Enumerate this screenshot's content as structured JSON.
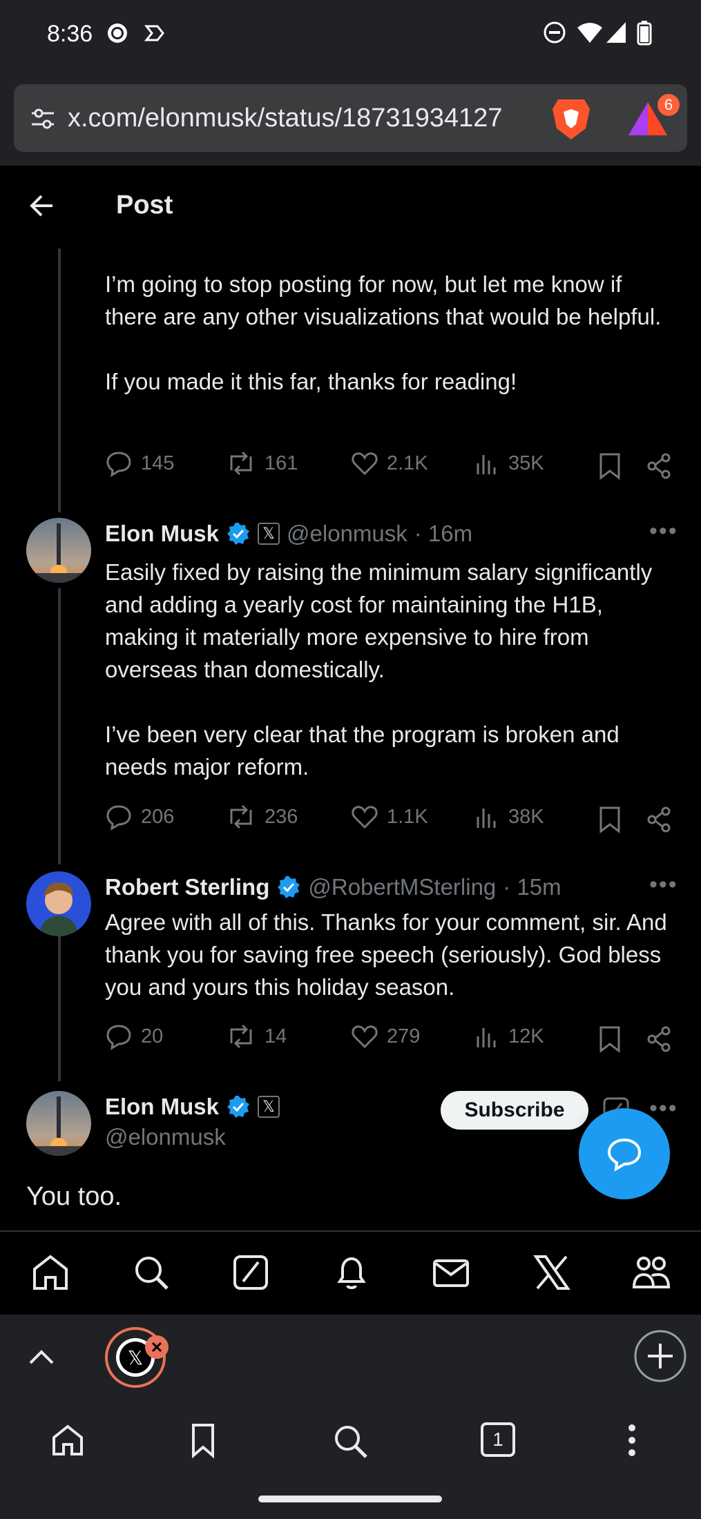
{
  "status_bar": {
    "time": "8:36"
  },
  "browser": {
    "url": "x.com/elonmusk/status/18731934127",
    "notification_count": "6",
    "tab_count": "1"
  },
  "header": {
    "title": "Post"
  },
  "thread": [
    {
      "text": "I’m going to stop posting for now, but let me know if there are any other visualizations that would be helpful.\n\nIf you made it this far, thanks for reading!",
      "stats": {
        "replies": "145",
        "reposts": "161",
        "likes": "2.1K",
        "views": "35K"
      }
    },
    {
      "name": "Elon Musk",
      "handle": "@elonmusk",
      "time": "· 16m",
      "text": "Easily fixed by raising the minimum salary significantly and adding a yearly cost for maintaining the H1B, making it materially more expensive to hire from overseas than domestically.\n\nI’ve been very clear that the program is broken and needs major reform.",
      "stats": {
        "replies": "206",
        "reposts": "236",
        "likes": "1.1K",
        "views": "38K"
      }
    },
    {
      "name": "Robert Sterling",
      "handle": "@RobertMSterling",
      "time": "· 15m",
      "text": "Agree with all of this. Thanks for your comment, sir. And thank you for saving free speech (seriously). God bless you and yours this holiday season.",
      "stats": {
        "replies": "20",
        "reposts": "14",
        "likes": "279",
        "views": "12K"
      }
    }
  ],
  "main_post": {
    "name": "Elon Musk",
    "handle": "@elonmusk",
    "subscribe_label": "Subscribe",
    "text": "You too."
  },
  "colors": {
    "accent": "#1d9bf0",
    "verified": "#1d9bf0",
    "text": "#e7e9ea",
    "muted": "#71767b",
    "brave_badge": "#ff5f3b"
  }
}
